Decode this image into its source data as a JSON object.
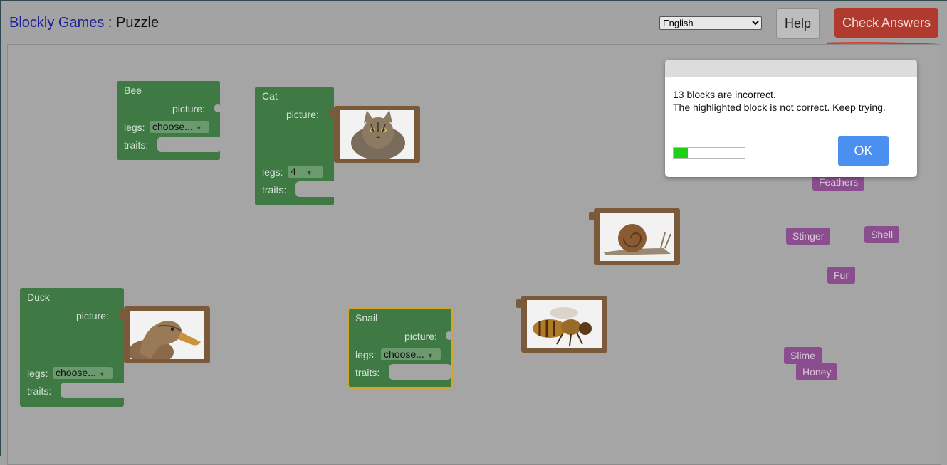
{
  "header": {
    "app_name": "Blockly Games",
    "separator": " : ",
    "page_name": "Puzzle",
    "language": "English",
    "language_options": [
      "English"
    ],
    "help_label": "Help",
    "check_label": "Check Answers"
  },
  "blocks": {
    "bee": {
      "name": "Bee",
      "picture": "picture:",
      "legs": "legs:",
      "legs_value": "choose...",
      "traits": "traits:"
    },
    "cat": {
      "name": "Cat",
      "picture": "picture:",
      "legs": "legs:",
      "legs_value": "4",
      "traits": "traits:"
    },
    "duck": {
      "name": "Duck",
      "picture": "picture:",
      "legs": "legs:",
      "legs_value": "choose...",
      "traits": "traits:"
    },
    "snail": {
      "name": "Snail",
      "picture": "picture:",
      "legs": "legs:",
      "legs_value": "choose...",
      "traits": "traits:"
    }
  },
  "traits": [
    "Feathers",
    "Stinger",
    "Shell",
    "Fur",
    "Slime",
    "Honey"
  ],
  "dialog": {
    "line1": "13 blocks are incorrect.",
    "line2": "The highlighted block is not correct. Keep trying.",
    "ok_label": "OK",
    "progress": 0.2
  },
  "colors": {
    "animal_block": "#3f7a45",
    "picture_block": "#7b5a3c",
    "trait_block": "#8a4e8f",
    "check_button": "#b03a2e",
    "ok_button": "#4a90f0",
    "highlight": "#d4a62a",
    "annotation": "#e0302a"
  }
}
